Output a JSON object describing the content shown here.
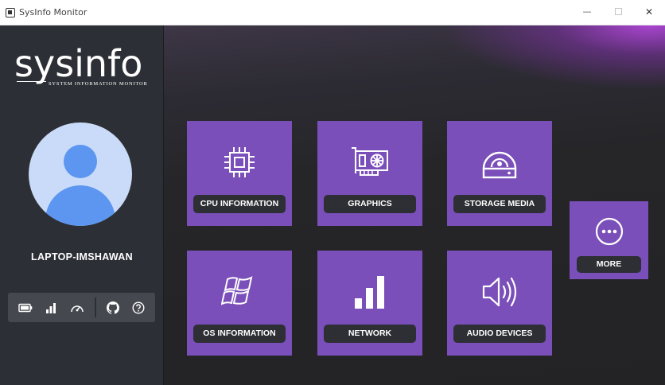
{
  "window": {
    "title": "SysInfo Monitor",
    "controls": {
      "minimize": "—",
      "close": "✕"
    }
  },
  "sidebar": {
    "logo": {
      "title": "sysinfo",
      "subtitle": "SYSTEM INFORMATION MONITOR"
    },
    "computer_name": "LAPTOP-IMSHAWAN",
    "toolbar_icons": [
      "battery-icon",
      "signal-bars-icon",
      "speedometer-icon",
      "github-icon",
      "help-icon"
    ]
  },
  "tiles": [
    {
      "id": "cpu",
      "label": "CPU INFORMATION",
      "icon": "cpu-chip-icon"
    },
    {
      "id": "graphics",
      "label": "GRAPHICS",
      "icon": "graphics-card-icon"
    },
    {
      "id": "storage",
      "label": "STORAGE MEDIA",
      "icon": "hard-disk-icon"
    },
    {
      "id": "more",
      "label": "MORE",
      "icon": "more-dots-icon"
    },
    {
      "id": "os",
      "label": "OS INFORMATION",
      "icon": "windows-logo-icon"
    },
    {
      "id": "network",
      "label": "NETWORK",
      "icon": "network-bars-icon"
    },
    {
      "id": "audio",
      "label": "AUDIO DEVICES",
      "icon": "speaker-icon"
    }
  ],
  "colors": {
    "tile": "#7a4fb9",
    "sidebar": "#2c2f35",
    "label_bg": "#2e2f34",
    "avatar_bg": "#c9dbf8",
    "avatar_fg": "#5c96f0"
  }
}
